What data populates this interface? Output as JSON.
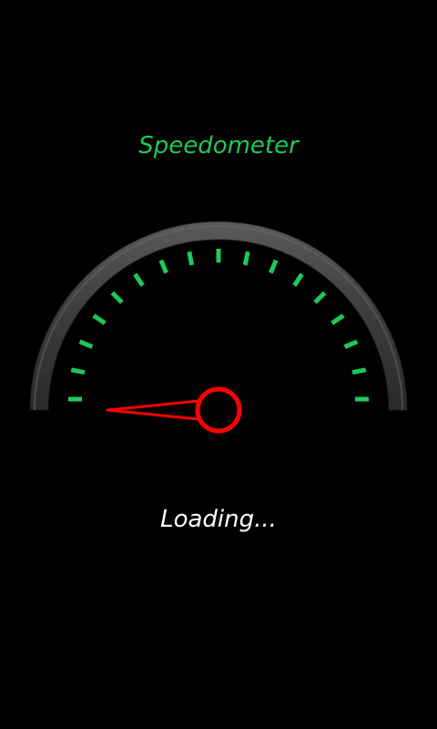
{
  "app": {
    "title": "Speedometer"
  },
  "status": {
    "text": "Loading..."
  },
  "gauge": {
    "tick_count": 17,
    "needle_fraction": 0.0,
    "colors": {
      "ticks": "#1ec85a",
      "needle": "#ff0000",
      "rim_outer": "#4a4a4a",
      "rim_inner": "#262626",
      "background": "#000000"
    }
  }
}
